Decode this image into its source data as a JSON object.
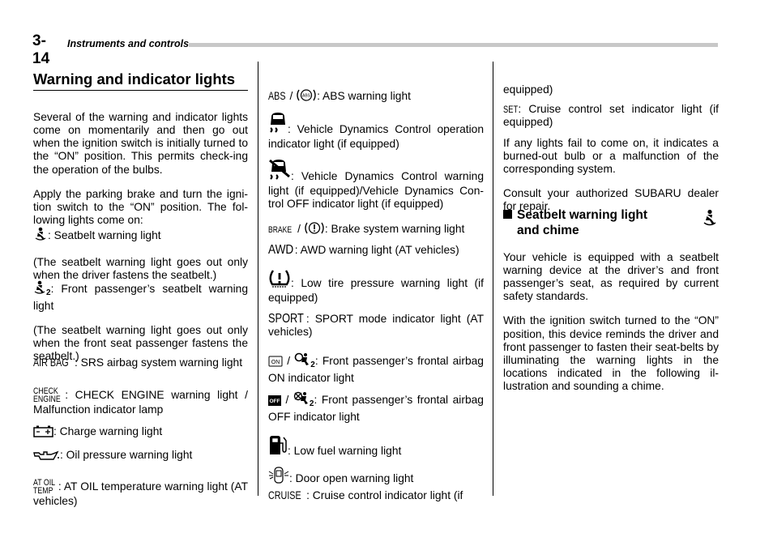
{
  "header": {
    "page_number": "3-14",
    "chapter_title": "Instruments and controls"
  },
  "section": {
    "title": "Warning and indicator lights"
  },
  "column1": {
    "intro_p1": "Several of the warning and indicator lights come on momentarily and then go out when the ignition switch is initially turned to the “ON” position. This permits check-ing the operation of the bulbs.",
    "intro_p2": "Apply the parking brake and turn the igni-tion switch to the “ON” position. The fol-lowing lights come on:",
    "items": [
      {
        "icon": "seatbelt-icon",
        "text": ": Seatbelt warning light",
        "note": "(The seatbelt warning light goes out only when the driver fastens the seatbelt.)"
      },
      {
        "icon": "passenger-seatbelt-icon",
        "icon_sub": "2",
        "text": ": Front passenger’s seatbelt warning light",
        "note": "(The seatbelt warning light goes out only when the front seat passenger fastens the seatbelt.)"
      },
      {
        "icon": "airbag-label-icon",
        "icon_text": "AIR BAG",
        "text": ": SRS airbag system warning light"
      },
      {
        "icon": "check-engine-label-icon",
        "icon_text_top": "CHECK",
        "icon_text_bottom": "ENGINE",
        "text": ": CHECK ENGINE warning light / Malfunction indicator lamp"
      },
      {
        "icon": "battery-icon",
        "text": ": Charge warning light"
      },
      {
        "icon": "oil-can-icon",
        "text": ": Oil pressure warning light"
      },
      {
        "icon": "at-oil-temp-label-icon",
        "icon_text_top": "AT OIL",
        "icon_text_bottom": "TEMP",
        "text": ": AT OIL temperature warning light (AT vehicles)"
      }
    ]
  },
  "column2": {
    "items": [
      {
        "icon": "abs-icon",
        "icon_text": "ABS",
        "separator": "/",
        "text": ": ABS warning light"
      },
      {
        "icon": "vdc-operation-icon",
        "text": ": Vehicle Dynamics Control operation indicator light (if equipped)"
      },
      {
        "icon": "vdc-off-icon",
        "text": ": Vehicle Dynamics Control warning light (if equipped)/Vehicle Dynamics Con-trol OFF indicator light (if equipped)"
      },
      {
        "icon": "brake-icon",
        "icon_text": "BRAKE",
        "separator": "/",
        "text": ": Brake system warning light"
      },
      {
        "icon": "awd-label-icon",
        "icon_text": "AWD",
        "text": ": AWD warning light (AT vehicles)"
      },
      {
        "icon": "tire-pressure-icon",
        "text": ": Low tire pressure warning light (if equipped)"
      },
      {
        "icon": "sport-label-icon",
        "icon_text": "SPORT",
        "text": ": SPORT mode indicator light (AT vehicles)"
      },
      {
        "icon": "airbag-on-icon",
        "icon_text": "ON",
        "separator": "/",
        "icon_sub": "2",
        "text": ": Front passenger’s frontal airbag ON indicator light"
      },
      {
        "icon": "airbag-off-icon",
        "icon_text": "OFF",
        "separator": "/",
        "icon_sub": "2",
        "text": ": Front passenger’s frontal airbag OFF indicator light"
      },
      {
        "icon": "low-fuel-icon",
        "text": ": Low fuel warning light"
      },
      {
        "icon": "door-open-icon",
        "text": ": Door open warning light"
      },
      {
        "icon": "cruise-label-icon",
        "icon_text": "CRUISE",
        "text": ": Cruise control indicator light (if"
      }
    ]
  },
  "column3": {
    "continued": "equipped)",
    "set_icon_text": "SET",
    "set_text": ": Cruise control set indicator light (if equipped)",
    "para1": "If any lights fail to come on, it indicates a burned-out bulb or a malfunction of the corresponding system.",
    "para2": "Consult your authorized SUBARU dealer for repair.",
    "subheading_line1": "Seatbelt warning light",
    "subheading_line2": "and chime",
    "body1": "Your vehicle is equipped with a seatbelt warning device at the driver’s and front passenger’s seat, as required by current safety standards.",
    "body2": "With the ignition switch turned to the “ON” position, this device reminds the driver and front passenger to fasten their seat-belts by illuminating the warning lights in the locations indicated in the following il-lustration and sounding a chime."
  }
}
